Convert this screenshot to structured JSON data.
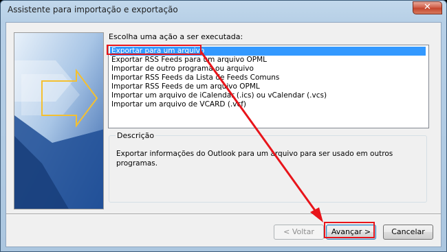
{
  "window": {
    "title": "Assistente para importação e exportação"
  },
  "wizard": {
    "prompt": "Escolha uma ação a ser executada:",
    "actions": [
      "Exportar para um arquivo",
      "Exportar RSS Feeds para um arquivo OPML",
      "Importar de outro programa ou arquivo",
      "Importar RSS Feeds da Lista de Feeds Comuns",
      "Importar RSS Feeds de um arquivo OPML",
      "Importar um arquivo de iCalendar (.ics) ou vCalendar (.vcs)",
      "Importar um arquivo de VCARD (.vcf)"
    ],
    "selected_index": 0,
    "description_label": "Descrição",
    "description_text": "Exportar informações do Outlook para um arquivo para ser usado em outros programas."
  },
  "buttons": {
    "back": "< Voltar",
    "next": "Avançar >",
    "cancel": "Cancelar"
  },
  "icons": {
    "close": "close-icon"
  },
  "colors": {
    "selection": "#3399ff",
    "annotation": "#e8141a"
  }
}
